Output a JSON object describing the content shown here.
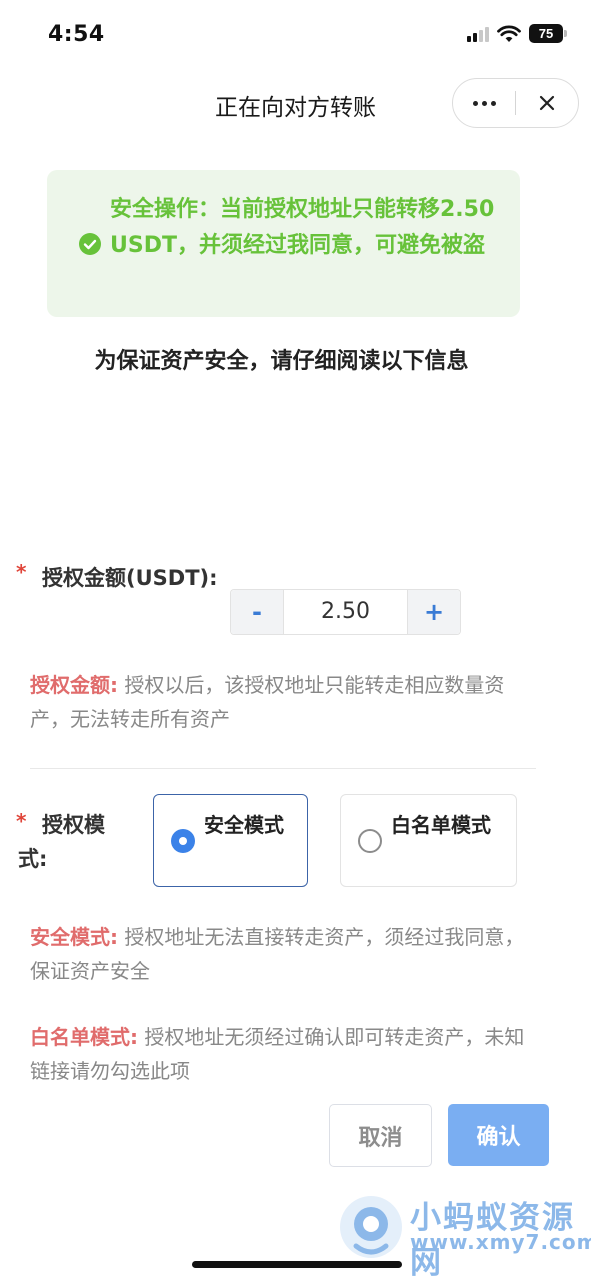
{
  "status_bar": {
    "time": "4:54",
    "battery": "75"
  },
  "nav": {
    "title": "正在向对方转账"
  },
  "notice": {
    "text": "安全操作：当前授权地址只能转移2.50 USDT，并须经过我同意，可避免被盗",
    "color": "#67c23a"
  },
  "subtitle": "为保证资产安全，请仔细阅读以下信息",
  "amount": {
    "required_mark": "*",
    "label": "授权金额(USDT):",
    "minus": "-",
    "value": "2.50",
    "plus": "+"
  },
  "amount_desc": {
    "highlight": "授权金额:",
    "text": " 授权以后，该授权地址只能转走相应数量资产，无法转走所有资产"
  },
  "mode": {
    "required_mark": "*",
    "label": "授权模式:",
    "options": [
      {
        "label": "安全模式",
        "selected": true
      },
      {
        "label": "白名单模式",
        "selected": false
      }
    ]
  },
  "safe_desc": {
    "highlight": "安全模式:",
    "text": " 授权地址无法直接转走资产，须经过我同意，保证资产安全"
  },
  "whitelist_desc": {
    "highlight": "白名单模式:",
    "text": " 授权地址无须经过确认即可转走资产，未知链接请勿勾选此项"
  },
  "buttons": {
    "cancel": "取消",
    "confirm": "确认"
  },
  "watermark": {
    "name": "小蚂蚁资源网",
    "url": "www.xmy7.com"
  },
  "colors": {
    "accent": "#3b82e8",
    "confirm_bg": "#7aaef2",
    "highlight_red": "#e06c6c",
    "required_red": "#e0453a"
  }
}
